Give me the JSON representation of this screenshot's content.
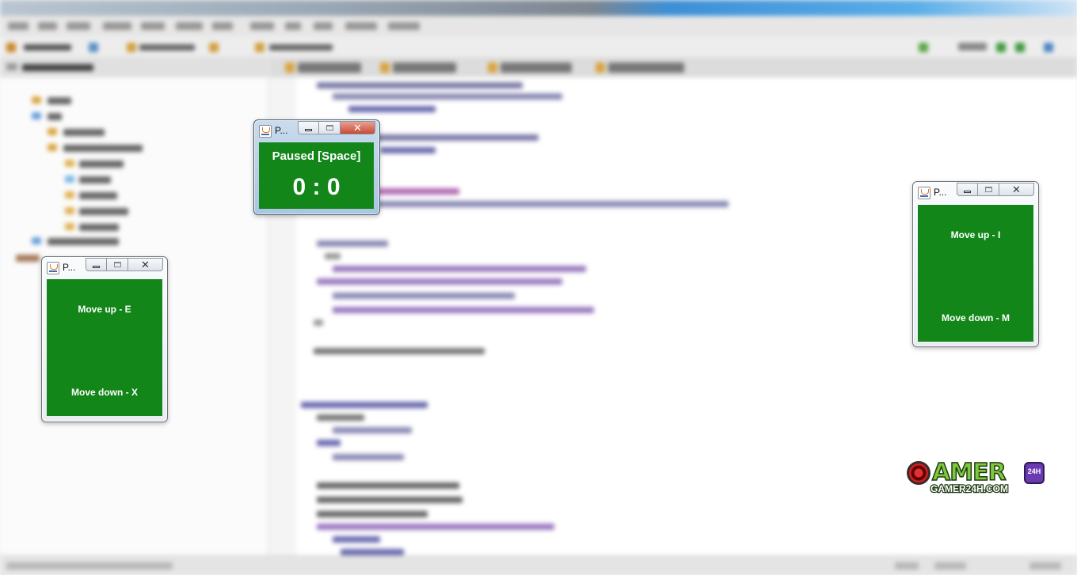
{
  "windows": {
    "scoreboard": {
      "title": "P...",
      "status": "Paused [Space]",
      "score": "0 : 0"
    },
    "left_player": {
      "title": "P...",
      "move_up": "Move up - E",
      "move_down": "Move down - X"
    },
    "right_player": {
      "title": "P...",
      "move_up": "Move up - I",
      "move_down": "Move down - M"
    }
  },
  "window_controls": {
    "minimize_icon": "minimize-icon",
    "maximize_icon": "maximize-icon",
    "close_glyph": "✕"
  },
  "watermark": {
    "logo_word": "AMER",
    "badge": "24H",
    "site": "GAMER24H.COM"
  },
  "colors": {
    "panel_green": "#138619",
    "panel_text": "#ffffff"
  }
}
